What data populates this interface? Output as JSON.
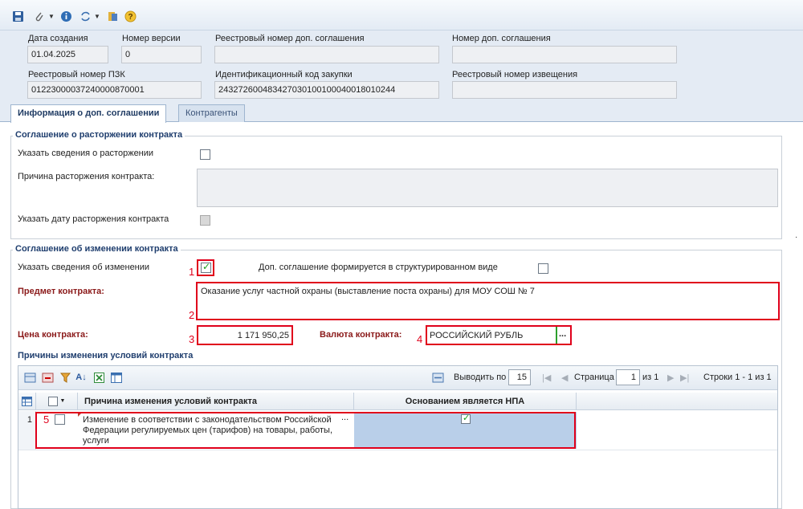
{
  "toolbar": {
    "icons": [
      "save-icon",
      "attach-icon",
      "info-icon",
      "refresh-icon",
      "export-icon",
      "help-icon"
    ]
  },
  "header": {
    "created_label": "Дата создания",
    "created_value": "01.04.2025",
    "version_label": "Номер версии",
    "version_value": "0",
    "reg_num_add_label": "Реестровый номер доп. соглашения",
    "reg_num_add_value": "",
    "add_num_label": "Номер доп. соглашения",
    "add_num_value": "",
    "pzk_label": "Реестровый номер ПЗК",
    "pzk_value": "01223000037240000870001",
    "ikz_label": "Идентификационный код закупки",
    "ikz_value": "243272600483427030100100040018010244",
    "notice_label": "Реестровый номер извещения",
    "notice_value": ""
  },
  "tabs": [
    {
      "label": "Информация о доп. соглашении",
      "active": true
    },
    {
      "label": "Контрагенты",
      "active": false
    }
  ],
  "termination": {
    "title": "Соглашение о расторжении контракта",
    "specify_label": "Указать сведения о расторжении",
    "reason_label": "Причина расторжения контракта:",
    "reason_value": "",
    "date_label": "Указать дату расторжения контракта"
  },
  "change": {
    "title": "Соглашение об изменении контракта",
    "specify_label": "Указать сведения об изменении",
    "specify_checked": true,
    "structured_label": "Доп. соглашение формируется в структурированном виде",
    "structured_checked": false,
    "subject_label": "Предмет контракта:",
    "subject_value": "Оказание услуг частной охраны (выставление поста охраны) для МОУ СОШ № 7",
    "price_label": "Цена контракта:",
    "price_value": "1 171 950,25",
    "currency_label": "Валюта контракта:",
    "currency_value": "РОССИЙСКИЙ РУБЛЬ",
    "currency_btn": "...",
    "markers": [
      "1",
      "2",
      "3",
      "4",
      "5"
    ]
  },
  "reasons": {
    "title": "Причины изменения условий контракта",
    "pager": {
      "show_label": "Выводить по",
      "per_page": "15",
      "page_label": "Страница",
      "page_value": "1",
      "of_label": "из 1",
      "rows_label": "Строки 1 - 1 из 1"
    },
    "columns": [
      "Причина изменения условий контракта",
      "Основанием является НПА"
    ],
    "rows": [
      {
        "num": "1",
        "reason": "Изменение в соответствии с законодательством Российской Федерации регулируемых цен (тарифов) на товары, работы, услуги",
        "ellipsis": "...",
        "npa_checked": true
      }
    ]
  }
}
